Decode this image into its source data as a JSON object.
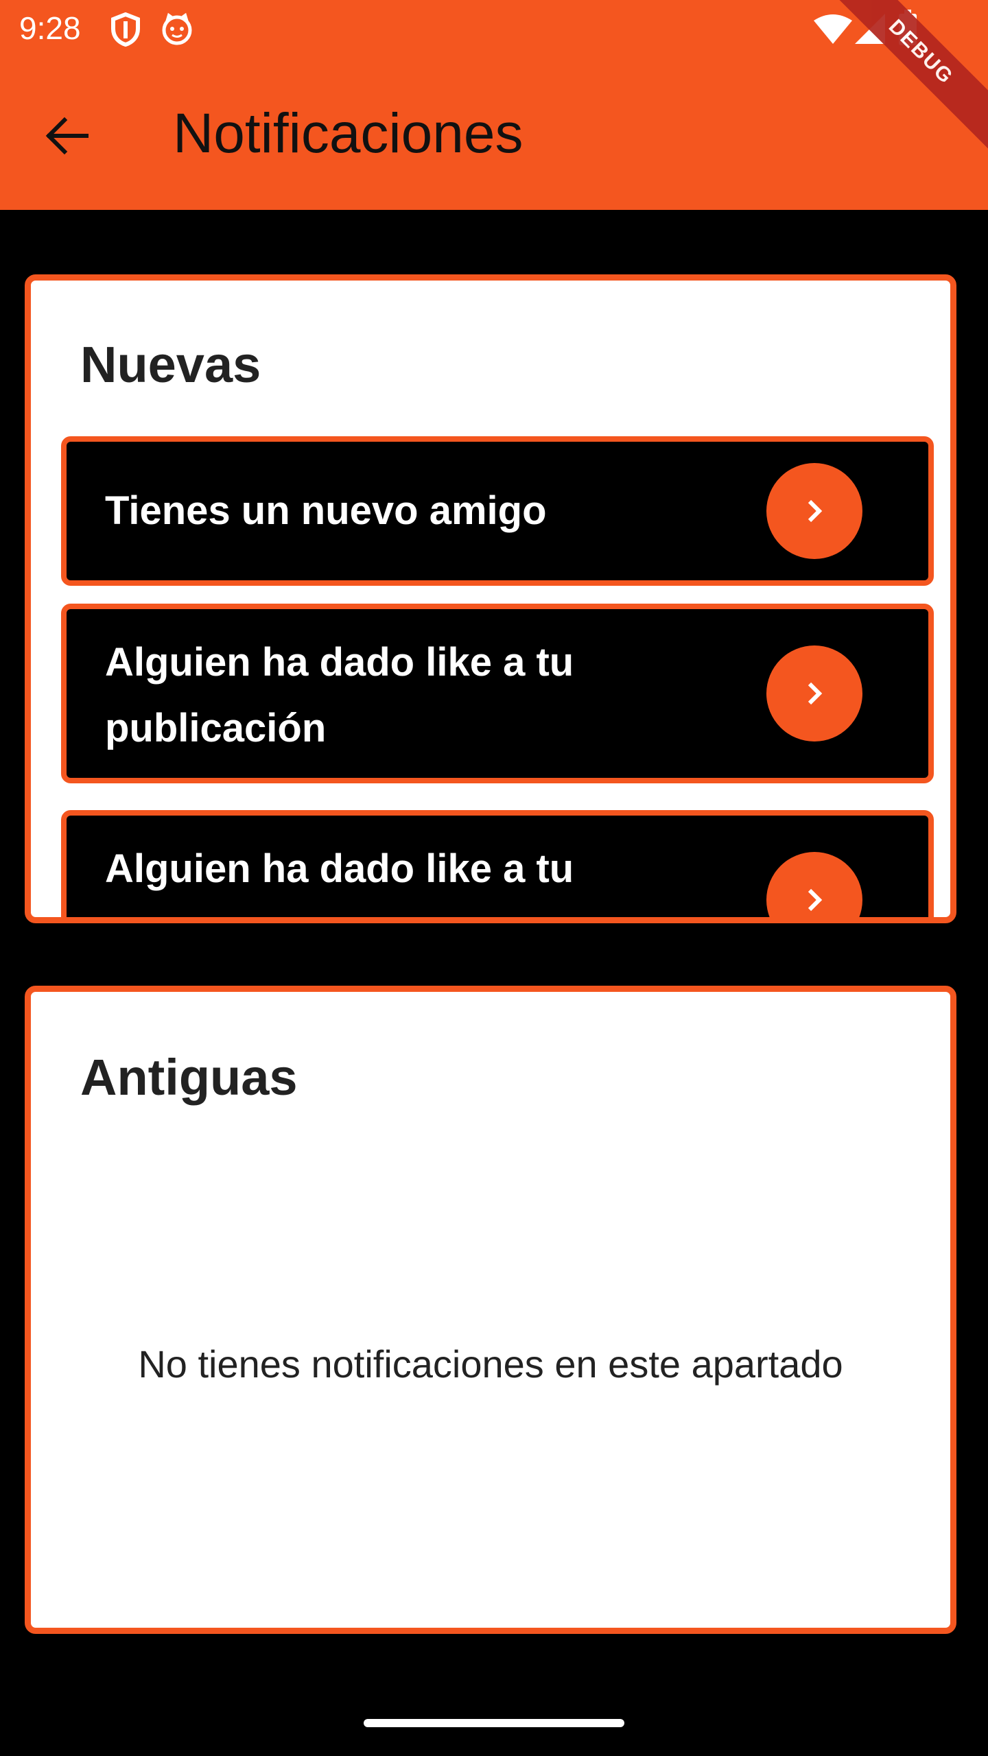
{
  "status_bar": {
    "time": "9:28",
    "left_icons": [
      "shield-icon",
      "cat-face-icon"
    ],
    "right_icons": [
      "wifi-icon",
      "signal-icon",
      "battery-icon"
    ],
    "debug_banner": "DEBUG"
  },
  "app_bar": {
    "back_icon": "arrow-left-icon",
    "title": "Notificaciones"
  },
  "sections": {
    "new": {
      "heading": "Nuevas",
      "items": [
        {
          "text": "Tienes un nuevo amigo",
          "action_icon": "chevron-right-icon"
        },
        {
          "text": "Alguien ha dado like a tu publicación",
          "action_icon": "chevron-right-icon"
        },
        {
          "text": "Alguien ha dado like a tu",
          "action_icon": "chevron-right-icon"
        }
      ]
    },
    "old": {
      "heading": "Antiguas",
      "empty_message": "No tienes notificaciones en este apartado"
    }
  },
  "colors": {
    "accent": "#F4561F",
    "background": "#000000",
    "card": "#FFFFFF"
  }
}
